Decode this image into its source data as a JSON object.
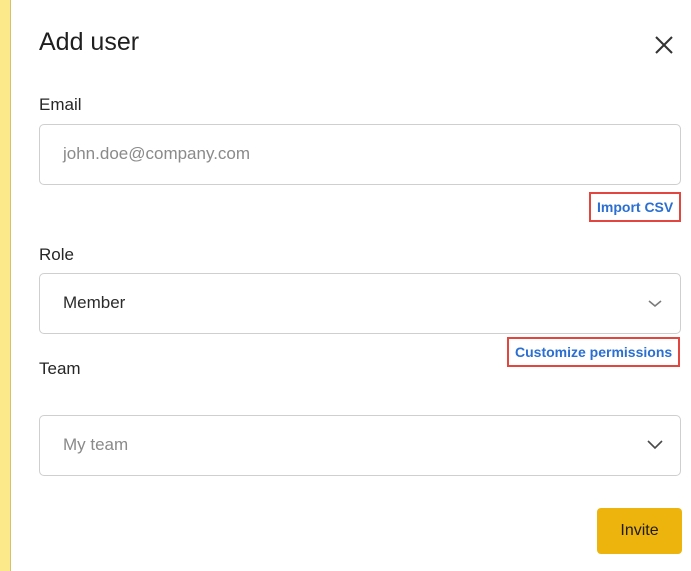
{
  "dialog": {
    "title": "Add user",
    "close_icon": "close-icon"
  },
  "email": {
    "label": "Email",
    "placeholder": "john.doe@company.com",
    "value": ""
  },
  "import_csv": {
    "label": "Import CSV"
  },
  "role": {
    "label": "Role",
    "selected": "Member",
    "icon": "chevron-down-icon"
  },
  "customize_permissions": {
    "label": "Customize permissions"
  },
  "team": {
    "label": "Team",
    "placeholder": "My team",
    "icon": "chevron-down-icon"
  },
  "actions": {
    "invite_label": "Invite"
  },
  "colors": {
    "accent": "#eeb40e",
    "link": "#2a6fd1",
    "highlight": "#e2473f",
    "background": "#fbe98a"
  }
}
